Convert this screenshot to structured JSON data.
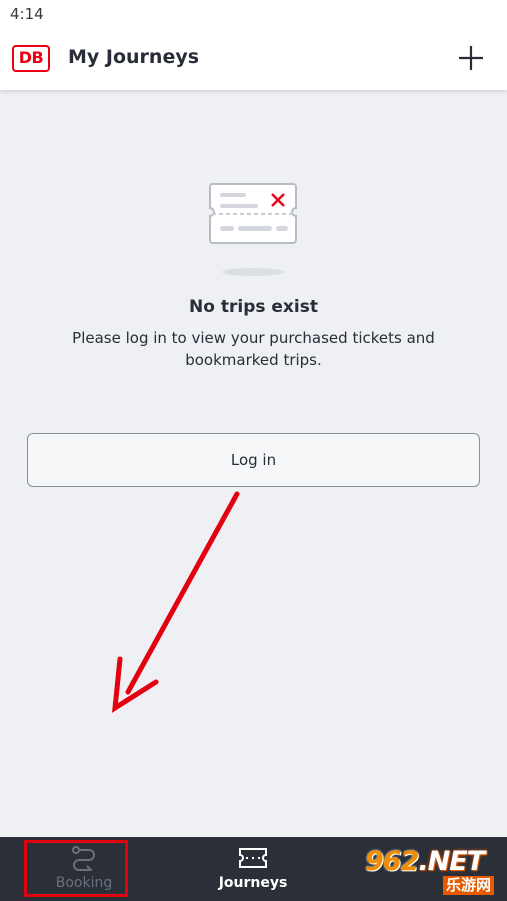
{
  "status_bar": {
    "time": "4:14"
  },
  "header": {
    "logo_text": "DB",
    "title": "My Journeys",
    "add_icon": "plus-icon"
  },
  "empty_state": {
    "illustration_icon": "ticket-cancelled-icon",
    "title": "No trips exist",
    "description": "Please log in to view your purchased tickets and bookmarked trips."
  },
  "login_button": {
    "label": "Log in"
  },
  "bottom_nav": {
    "items": [
      {
        "label": "Booking",
        "icon": "route-icon",
        "active": false
      },
      {
        "label": "Journeys",
        "icon": "ticket-icon",
        "active": true
      }
    ]
  },
  "watermark": {
    "brand_main": "962",
    "brand_suffix": ".NET",
    "brand_sub": "乐游网"
  },
  "colors": {
    "db_red": "#ec0016",
    "annotation_red": "#e3000f",
    "nav_background": "#2a2f38",
    "page_background": "#eef0f3"
  }
}
